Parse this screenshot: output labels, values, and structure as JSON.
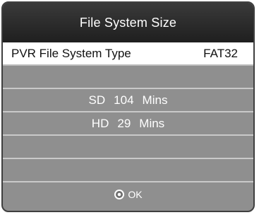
{
  "dialog": {
    "title": "File System Size",
    "pvr_type": {
      "label": "PVR File System Type",
      "value": "FAT32"
    },
    "sd": {
      "label": "SD",
      "value": "104",
      "unit": "Mins"
    },
    "hd": {
      "label": "HD",
      "value": "29",
      "unit": "Mins"
    },
    "ok_label": "OK"
  },
  "colors": {
    "dialog_bg": "#8f8f8f",
    "title_bar": "#2a2a2a",
    "highlight_row": "#ffffff",
    "divider": "#c9c9c9"
  },
  "icons": {
    "ok": "ok-circle-icon"
  }
}
